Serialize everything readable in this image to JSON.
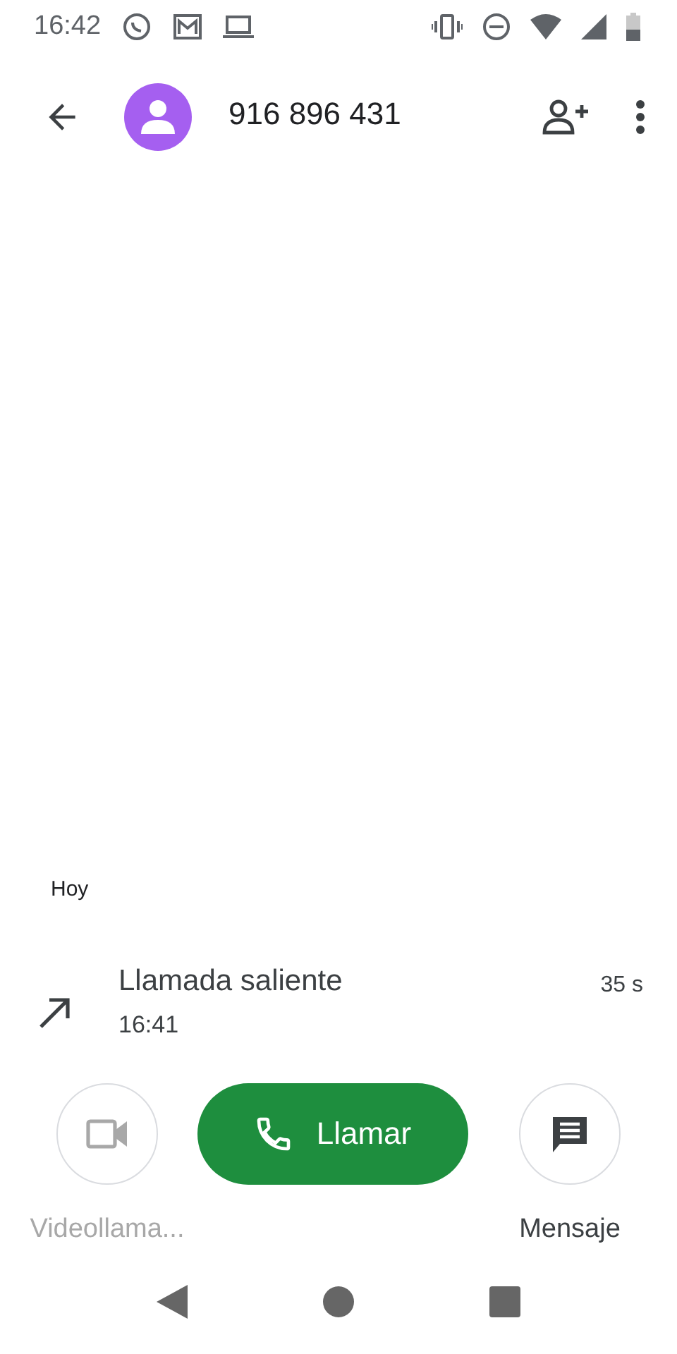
{
  "status_bar": {
    "time": "16:42"
  },
  "header": {
    "number": "916 896 431"
  },
  "history": {
    "day": "Hoy",
    "calls": [
      {
        "kind": "outgoing",
        "title": "Llamada saliente",
        "time": "16:41",
        "duration": "35 s"
      }
    ]
  },
  "actions": [
    {
      "kind": "video",
      "label": "Videollama...",
      "disabled": true
    },
    {
      "kind": "call",
      "label": "Llamar",
      "disabled": false
    },
    {
      "kind": "message",
      "label": "Mensaje",
      "disabled": false
    }
  ]
}
